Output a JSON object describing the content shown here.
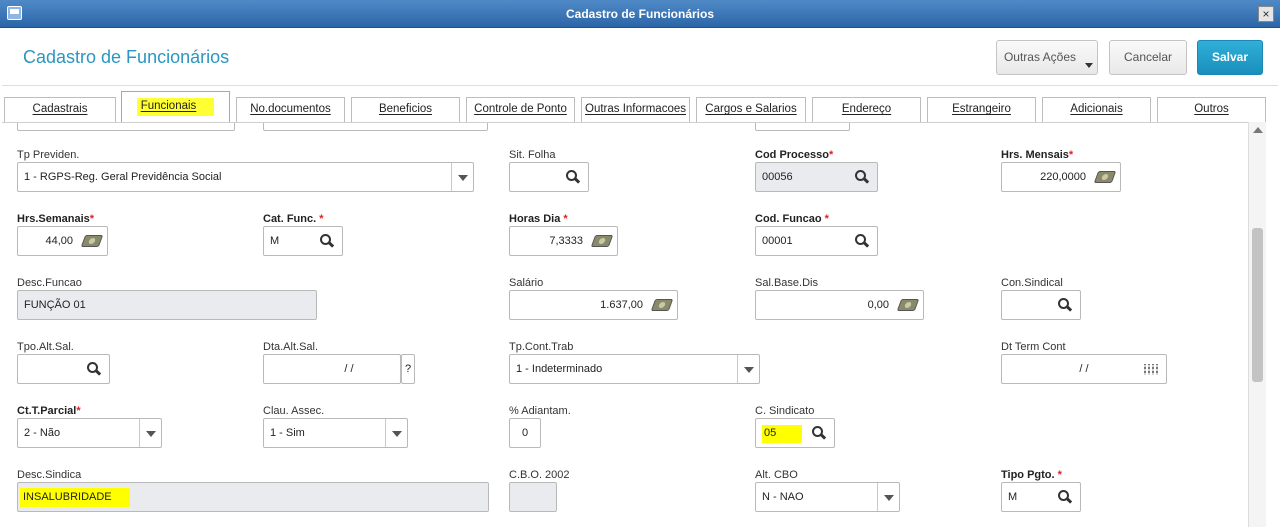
{
  "window": {
    "title": "Cadastro de Funcionários"
  },
  "header": {
    "title": "Cadastro de Funcionários",
    "more_actions": "Outras Ações",
    "cancel": "Cancelar",
    "save": "Salvar"
  },
  "tabs": [
    "Cadastrais",
    "Funcionais",
    "No.documentos",
    "Beneficios",
    "Controle de Ponto",
    "Outras Informacoes",
    "Cargos e Salarios",
    "Endereço",
    "Estrangeiro",
    "Adicionais",
    "Outros"
  ],
  "form": {
    "tp_previden": {
      "label": "Tp Previden.",
      "value": "1 - RGPS-Reg. Geral Previdência Social"
    },
    "sit_folha": {
      "label": "Sit. Folha",
      "value": ""
    },
    "cod_processo": {
      "label": "Cod Processo",
      "value": "00056"
    },
    "hrs_mensais": {
      "label": "Hrs. Mensais",
      "value": "220,0000"
    },
    "hrs_semanais": {
      "label": "Hrs.Semanais",
      "value": "44,00"
    },
    "cat_func": {
      "label": "Cat. Func.",
      "value": "M"
    },
    "horas_dia": {
      "label": "Horas Dia",
      "value": "7,3333"
    },
    "cod_funcao": {
      "label": "Cod. Funcao",
      "value": "00001"
    },
    "desc_funcao": {
      "label": "Desc.Funcao",
      "value": "FUNÇÃO 01"
    },
    "salario": {
      "label": "Salário",
      "value": "1.637,00"
    },
    "sal_base_dis": {
      "label": "Sal.Base.Dis",
      "value": "0,00"
    },
    "con_sindical": {
      "label": "Con.Sindical",
      "value": ""
    },
    "tpo_alt_sal": {
      "label": "Tpo.Alt.Sal.",
      "value": ""
    },
    "dta_alt_sal": {
      "label": "Dta.Alt.Sal.",
      "value": "/ /",
      "help": "?"
    },
    "tp_cont_trab": {
      "label": "Tp.Cont.Trab",
      "value": "1 - Indeterminado"
    },
    "dt_term_cont": {
      "label": "Dt Term Cont",
      "value": "/ /"
    },
    "ct_t_parcial": {
      "label": "Ct.T.Parcial",
      "value": "2 - Não"
    },
    "clau_assec": {
      "label": "Clau. Assec.",
      "value": "1 - Sim"
    },
    "adiantam": {
      "label": "% Adiantam.",
      "value": "0"
    },
    "c_sindicato": {
      "label": "C. Sindicato",
      "value": "05"
    },
    "desc_sindica": {
      "label": "Desc.Sindica",
      "value": "INSALUBRIDADE"
    },
    "cbo_2002": {
      "label": "C.B.O. 2002",
      "value": ""
    },
    "alt_cbo": {
      "label": "Alt. CBO",
      "value": "N - NAO"
    },
    "tipo_pgto": {
      "label": "Tipo Pgto.",
      "value": "M"
    }
  },
  "required_mark": "*"
}
